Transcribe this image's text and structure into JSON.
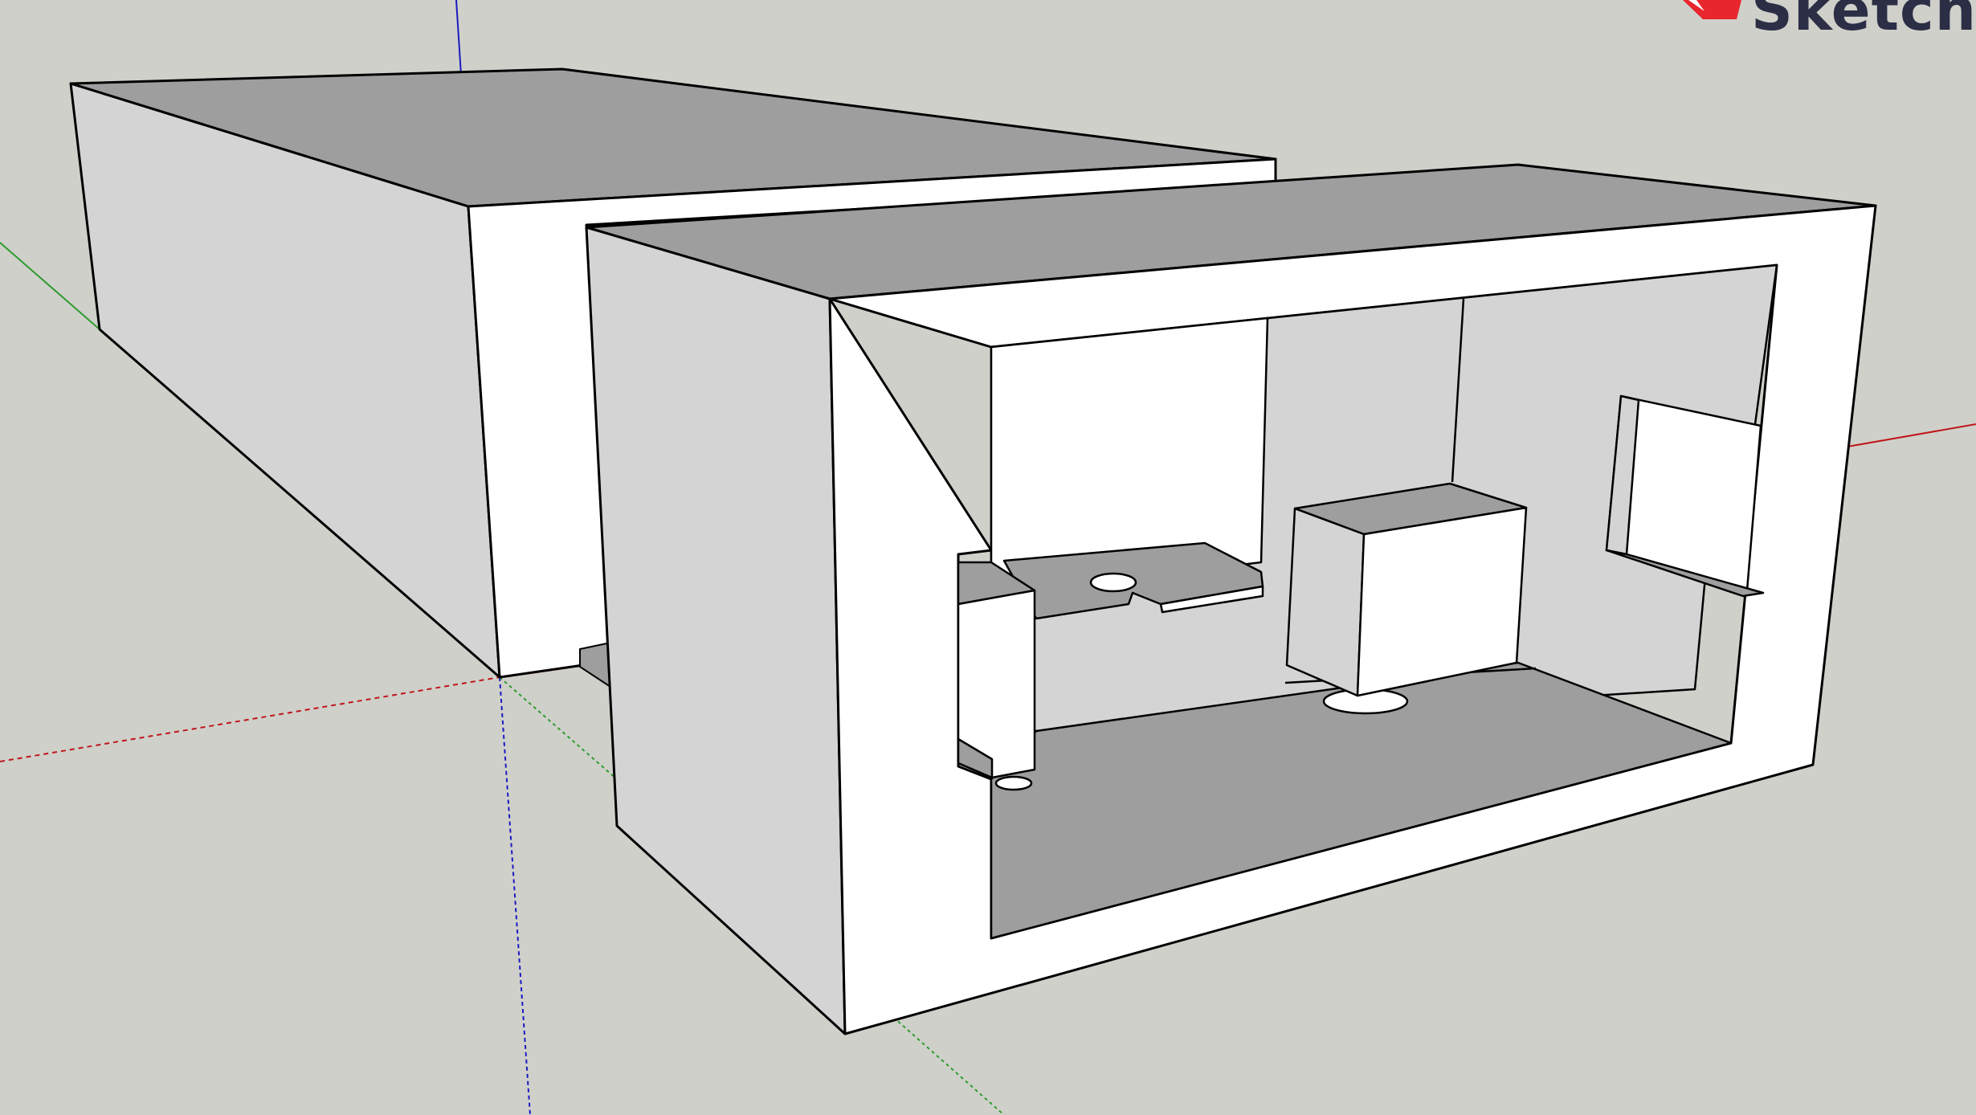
{
  "app": {
    "brand_text": "Sketchu"
  },
  "colors": {
    "background": "#cfd0ca",
    "face_light": "#ffffff",
    "face_side": "#d4d4d4",
    "face_dark": "#9e9e9e",
    "edge": "#000000",
    "axis_red": "#c0151b",
    "axis_green": "#2f9b2f",
    "axis_blue": "#1a1ac0",
    "brand_red": "#e8262e",
    "brand_navy": "#2b2e45"
  },
  "icons": {
    "brand_logo": "sketchup-logo-icon"
  }
}
